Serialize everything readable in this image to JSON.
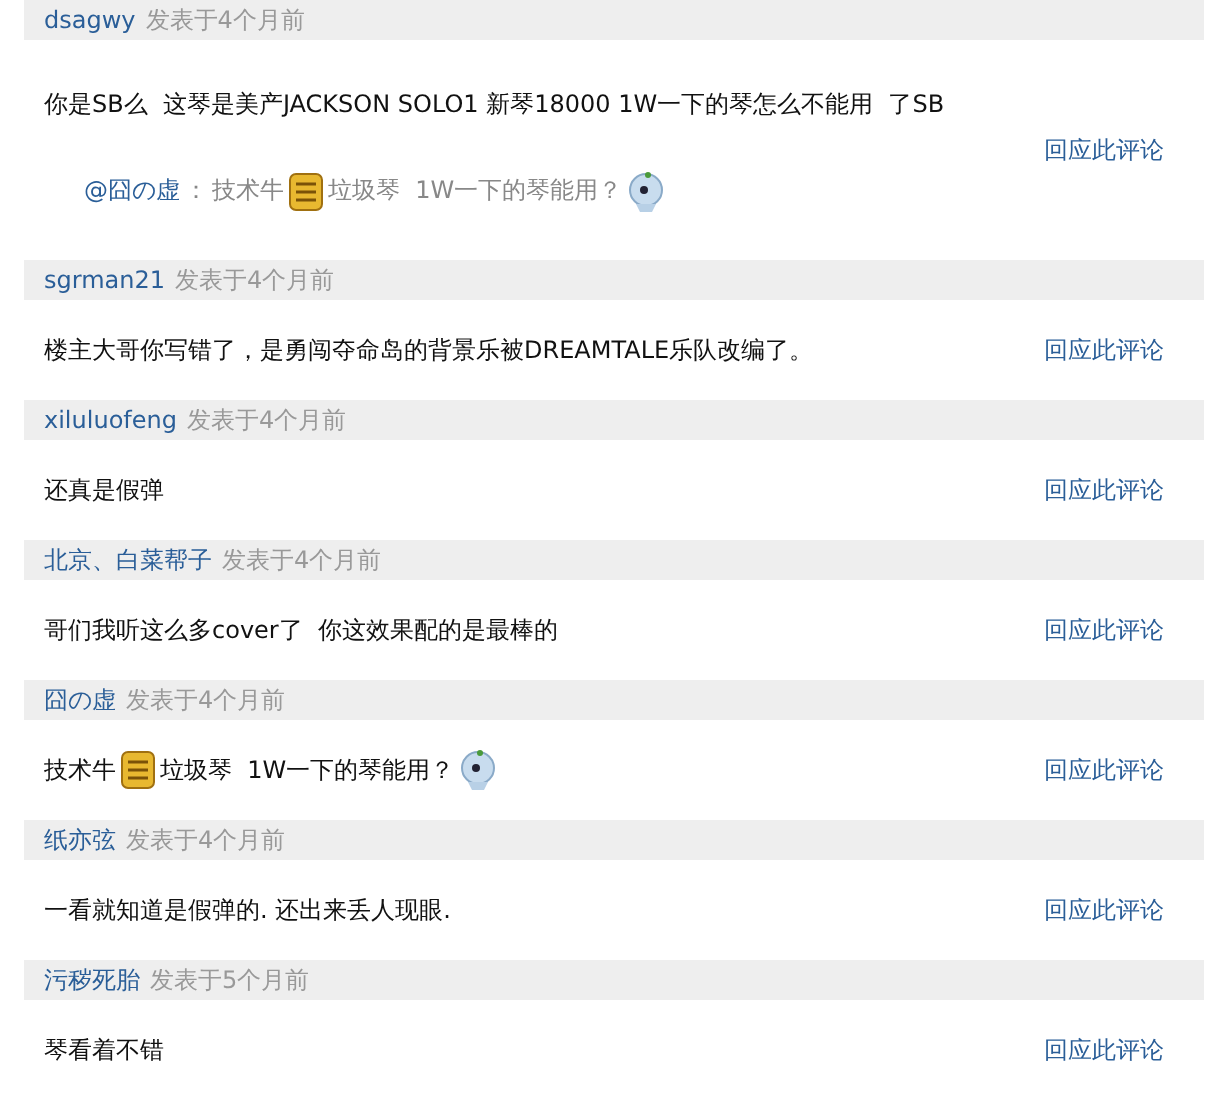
{
  "comments": [
    {
      "author": "dsagwy",
      "posted": "发表于4个月前",
      "body": [
        {
          "kind": "text",
          "text": "你是SB么  这琴是美产JACKSON SOLO1 新琴18000 1W一下的琴怎么不能用  了SB"
        }
      ],
      "quote": {
        "author": "@囧の虚",
        "separator": "：",
        "parts": [
          {
            "kind": "text",
            "text": "技术牛"
          },
          {
            "kind": "sticker"
          },
          {
            "kind": "text",
            "text": "垃圾琴  1W一下的琴能用？"
          },
          {
            "kind": "ghost"
          }
        ]
      },
      "reply_link": "回应此评论"
    },
    {
      "author": "sgrman21",
      "posted": "发表于4个月前",
      "body": [
        {
          "kind": "text",
          "text": "楼主大哥你写错了，是勇闯夺命岛的背景乐被DREAMTALE乐队改编了。"
        }
      ],
      "reply_link": "回应此评论"
    },
    {
      "author": "xiluluofeng",
      "posted": "发表于4个月前",
      "body": [
        {
          "kind": "text",
          "text": "还真是假弹"
        }
      ],
      "reply_link": "回应此评论"
    },
    {
      "author": "北京、白菜帮子",
      "posted": "发表于4个月前",
      "body": [
        {
          "kind": "text",
          "text": "哥们我听这么多cover了  你这效果配的是最棒的"
        }
      ],
      "reply_link": "回应此评论"
    },
    {
      "author": "囧の虚",
      "posted": "发表于4个月前",
      "body": [
        {
          "kind": "text",
          "text": "技术牛"
        },
        {
          "kind": "sticker"
        },
        {
          "kind": "text",
          "text": "垃圾琴  1W一下的琴能用？"
        },
        {
          "kind": "ghost"
        }
      ],
      "reply_link": "回应此评论"
    },
    {
      "author": "纸亦弦",
      "posted": "发表于4个月前",
      "body": [
        {
          "kind": "text",
          "text": "一看就知道是假弹的. 还出来丢人现眼."
        }
      ],
      "reply_link": "回应此评论"
    },
    {
      "author": "污秽死胎",
      "posted": "发表于5个月前",
      "body": [
        {
          "kind": "text",
          "text": "琴看着不错"
        }
      ],
      "reply_link": "回应此评论"
    }
  ]
}
